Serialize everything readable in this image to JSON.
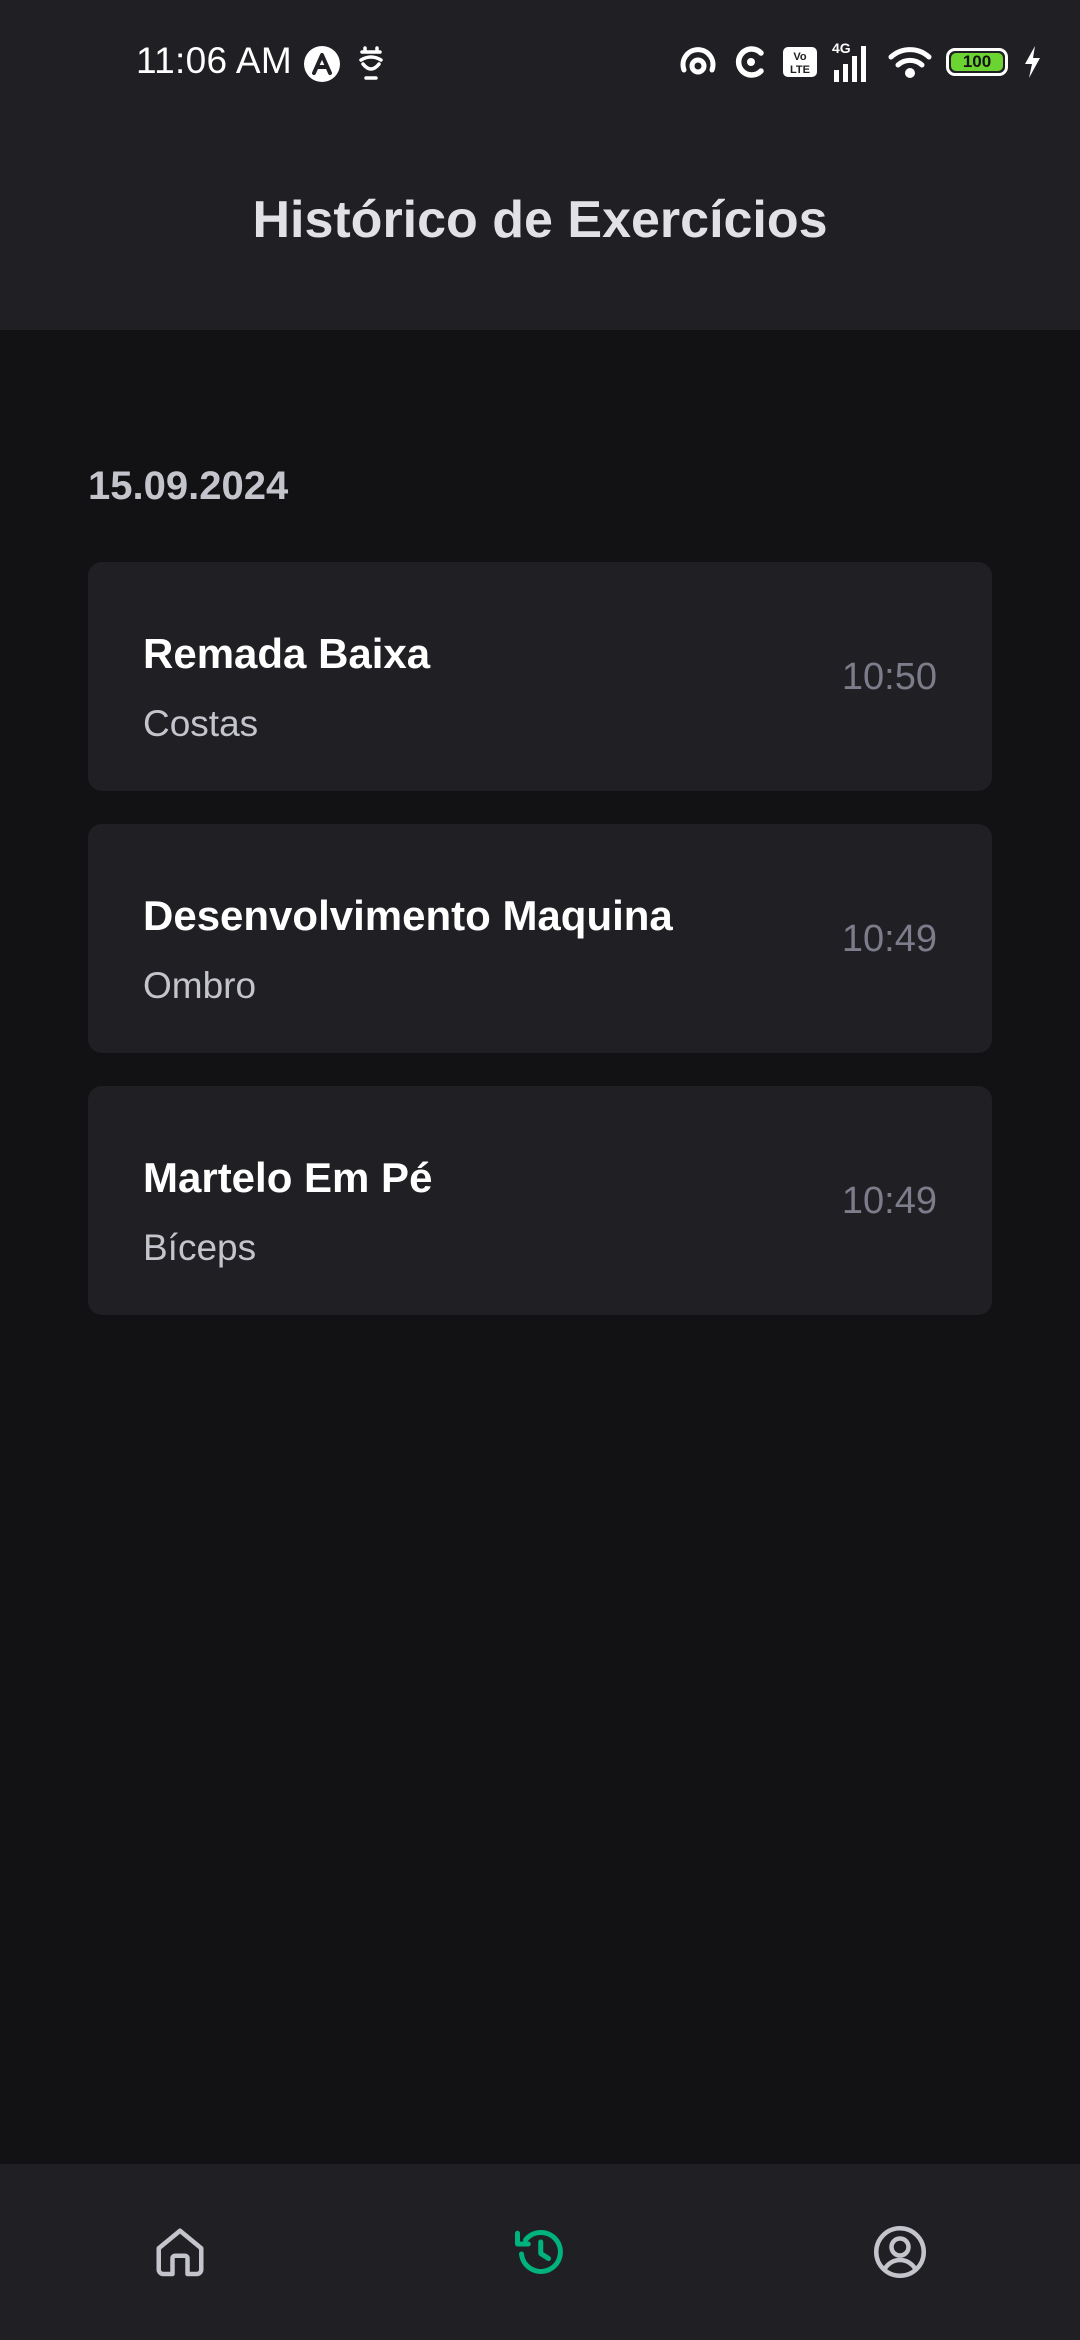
{
  "status_bar": {
    "time": "11:06 AM",
    "battery_level": "100",
    "icons": [
      "a-badge-icon",
      "notification-icon",
      "hotspot-icon",
      "sync-icon",
      "volte-icon",
      "network-4g-icon",
      "signal-icon",
      "wifi-icon",
      "battery-icon",
      "charging-icon"
    ]
  },
  "header": {
    "title": "Histórico de Exercícios"
  },
  "history": {
    "sections": [
      {
        "date": "15.09.2024",
        "items": [
          {
            "name": "Remada Baixa",
            "group": "Costas",
            "time": "10:50"
          },
          {
            "name": "Desenvolvimento Maquina",
            "group": "Ombro",
            "time": "10:49"
          },
          {
            "name": "Martelo Em Pé",
            "group": "Bíceps",
            "time": "10:49"
          }
        ]
      }
    ]
  },
  "bottom_nav": {
    "items": [
      {
        "icon": "home-icon",
        "active": false
      },
      {
        "icon": "history-icon",
        "active": true
      },
      {
        "icon": "profile-icon",
        "active": false
      }
    ],
    "active_color": "#00B37E",
    "inactive_color": "#C4C4CC"
  },
  "colors": {
    "background": "#121214",
    "surface": "#202024",
    "accent": "#00B37E"
  }
}
